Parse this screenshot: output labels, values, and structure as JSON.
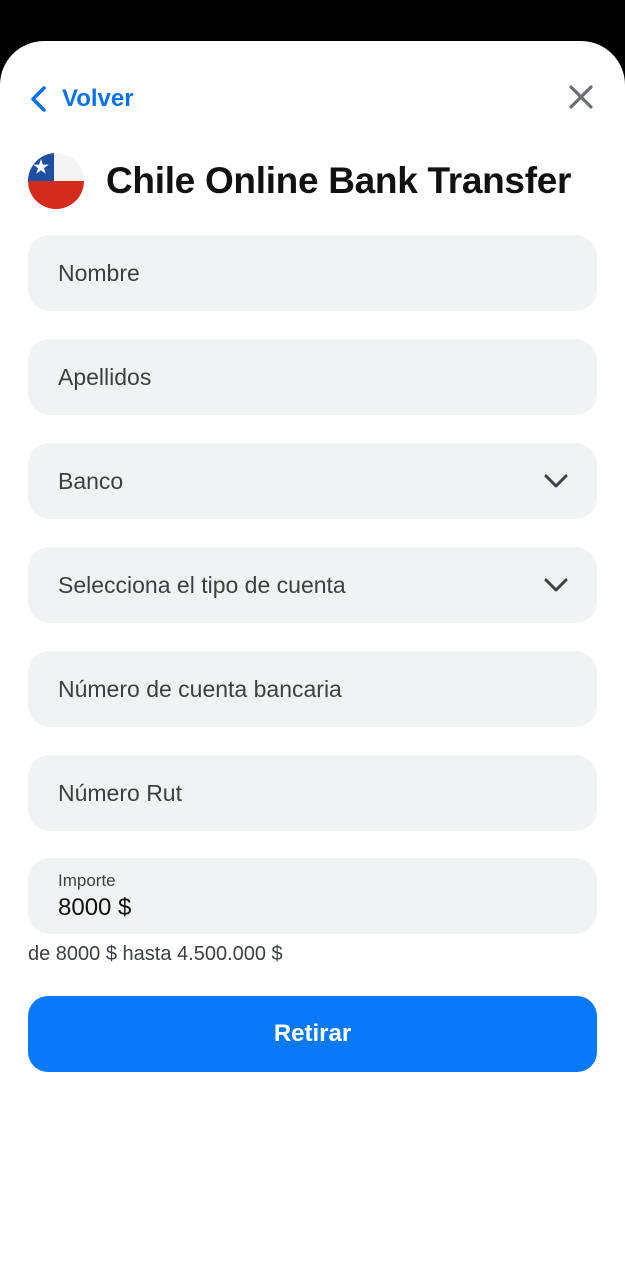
{
  "nav": {
    "back_label": "Volver",
    "back_icon": "chevron-left-icon",
    "close_icon": "close-icon"
  },
  "header": {
    "title": "Chile Online Bank Transfer",
    "flag_icon": "chile-flag-icon"
  },
  "form": {
    "first_name": {
      "placeholder": "Nombre"
    },
    "last_name": {
      "placeholder": "Apellidos"
    },
    "bank": {
      "placeholder": "Banco"
    },
    "account_type": {
      "placeholder": "Selecciona el tipo de cuenta"
    },
    "account_number": {
      "placeholder": "Número de cuenta bancaria"
    },
    "rut": {
      "placeholder": "Número Rut"
    },
    "amount": {
      "label": "Importe",
      "value": "8000 $"
    },
    "range_hint": "de 8000 $ hasta 4.500.000 $",
    "submit_label": "Retirar"
  },
  "colors": {
    "accent": "#0a79f7",
    "link": "#0a72e6",
    "field_bg": "#f1f2f4"
  }
}
